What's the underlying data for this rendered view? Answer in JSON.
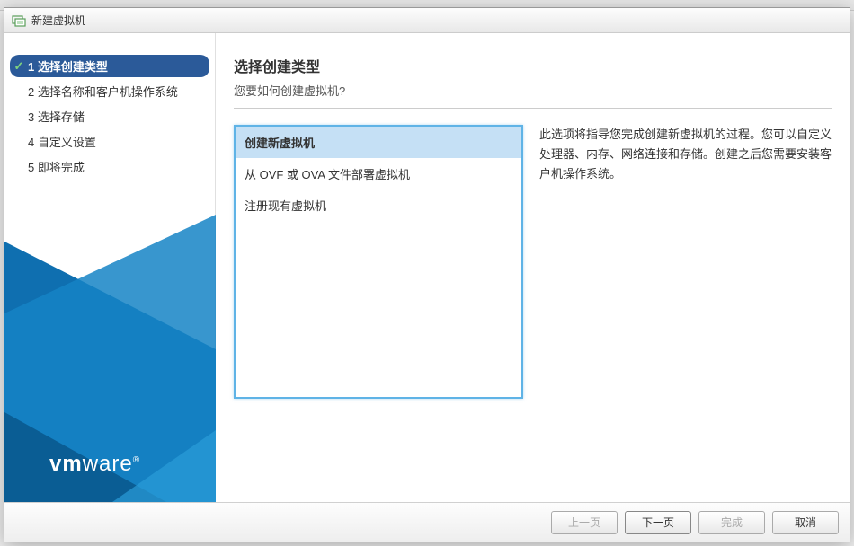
{
  "dialog": {
    "title": "新建虚拟机"
  },
  "steps": [
    {
      "num": "1",
      "label": "选择创建类型",
      "active": true,
      "checked": true
    },
    {
      "num": "2",
      "label": "选择名称和客户机操作系统",
      "active": false,
      "checked": false
    },
    {
      "num": "3",
      "label": "选择存储",
      "active": false,
      "checked": false
    },
    {
      "num": "4",
      "label": "自定义设置",
      "active": false,
      "checked": false
    },
    {
      "num": "5",
      "label": "即将完成",
      "active": false,
      "checked": false
    }
  ],
  "logo": {
    "bold": "vm",
    "rest": "ware",
    "reg": "®"
  },
  "main": {
    "heading": "选择创建类型",
    "subheading": "您要如何创建虚拟机?"
  },
  "options": [
    {
      "label": "创建新虚拟机",
      "selected": true
    },
    {
      "label": "从 OVF 或 OVA 文件部署虚拟机",
      "selected": false
    },
    {
      "label": "注册现有虚拟机",
      "selected": false
    }
  ],
  "description": "此选项将指导您完成创建新虚拟机的过程。您可以自定义处理器、内存、网络连接和存储。创建之后您需要安装客户机操作系统。",
  "buttons": {
    "back": "上一页",
    "next": "下一页",
    "finish": "完成",
    "cancel": "取消"
  }
}
